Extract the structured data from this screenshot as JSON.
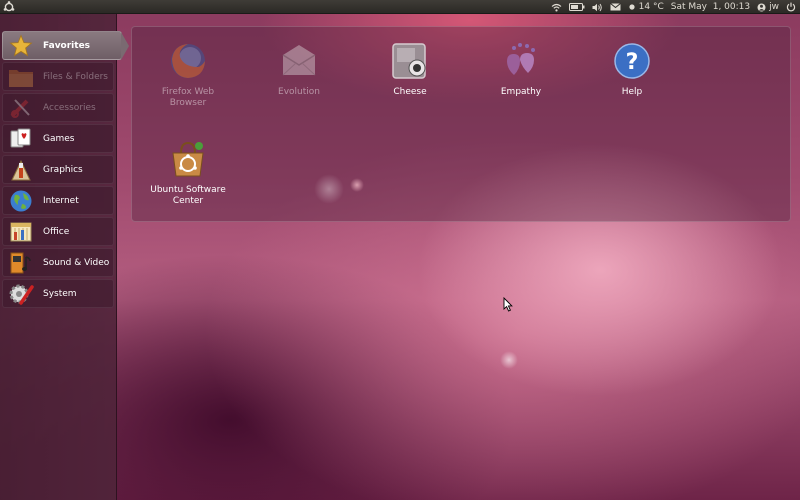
{
  "top_panel": {
    "menu_icon": "ubuntu-logo-icon",
    "weather": "14 °C",
    "datetime": "Sat May  1, 00:13",
    "user": "jw",
    "icons": [
      "wifi-icon",
      "battery-icon",
      "volume-icon",
      "mail-icon",
      "weather-icon",
      "user-icon",
      "power-icon"
    ]
  },
  "sidebar": {
    "items": [
      {
        "label": "Favorites",
        "icon": "star-icon",
        "state": "active"
      },
      {
        "label": "Files & Folders",
        "icon": "folder-icon",
        "state": "dimmed"
      },
      {
        "label": "Accessories",
        "icon": "accessories-icon",
        "state": "dimmed"
      },
      {
        "label": "Games",
        "icon": "cards-icon",
        "state": "normal"
      },
      {
        "label": "Graphics",
        "icon": "graphics-icon",
        "state": "normal"
      },
      {
        "label": "Internet",
        "icon": "globe-icon",
        "state": "normal"
      },
      {
        "label": "Office",
        "icon": "office-icon",
        "state": "normal"
      },
      {
        "label": "Sound & Video",
        "icon": "media-icon",
        "state": "normal"
      },
      {
        "label": "System",
        "icon": "system-icon",
        "state": "normal"
      }
    ]
  },
  "apps": [
    {
      "label": "Firefox Web Browser",
      "icon": "firefox-icon",
      "state": "dimmed"
    },
    {
      "label": "Evolution",
      "icon": "mail-envelope-icon",
      "state": "dimmed"
    },
    {
      "label": "Cheese",
      "icon": "webcam-icon",
      "state": "normal"
    },
    {
      "label": "Empathy",
      "icon": "empathy-icon",
      "state": "normal"
    },
    {
      "label": "Help",
      "icon": "help-icon",
      "state": "normal"
    },
    {
      "label": "Ubuntu Software Center",
      "icon": "software-center-icon",
      "state": "normal"
    }
  ],
  "colors": {
    "panel_bg": "#3f3c37",
    "sidebar_bg": "#46203a",
    "accent_pink": "#f4b0c4",
    "help_blue": "#3b6fc4"
  }
}
